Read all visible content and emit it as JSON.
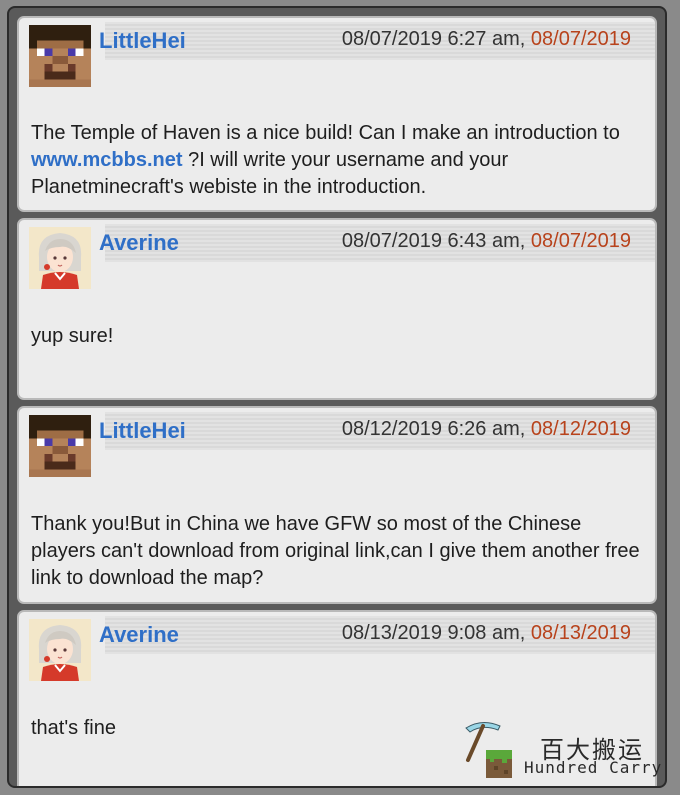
{
  "posts": [
    {
      "username": "LittleHei",
      "avatar": "steve-avatar-icon",
      "date": "08/07/2019 6:27 am",
      "separator": ", ",
      "edit_date": "08/07/2019",
      "body_before": "The Temple of Haven is a nice build! Can I make an introduction to ",
      "link": "www.mcbbs.net",
      "body_after": " ?I will write your username and your Planetminecraft's webiste in the introduction."
    },
    {
      "username": "Averine",
      "avatar": "anime-girl-avatar-icon",
      "date": "08/07/2019 6:43 am",
      "separator": ", ",
      "edit_date": "08/07/2019",
      "body": "yup sure!"
    },
    {
      "username": "LittleHei",
      "avatar": "steve-avatar-icon",
      "date": "08/12/2019 6:26 am",
      "separator": ", ",
      "edit_date": "08/12/2019",
      "body": "Thank you!But in China we have GFW so most of the Chinese players can't download from original link,can I give them another free link to download the map?"
    },
    {
      "username": "Averine",
      "avatar": "anime-girl-avatar-icon",
      "date": "08/13/2019 9:08 am",
      "separator": ", ",
      "edit_date": "08/13/2019",
      "body": "that's fine"
    }
  ],
  "watermark": {
    "chinese": "百大搬运",
    "english": "Hundred Carry",
    "icon": "pickaxe-grass-block-icon"
  },
  "colors": {
    "username": "#2f6fc7",
    "edit_date": "#b8431c",
    "link": "#2f6fc7",
    "post_bg": "#ececec",
    "frame_bg": "#5a5a5a"
  }
}
